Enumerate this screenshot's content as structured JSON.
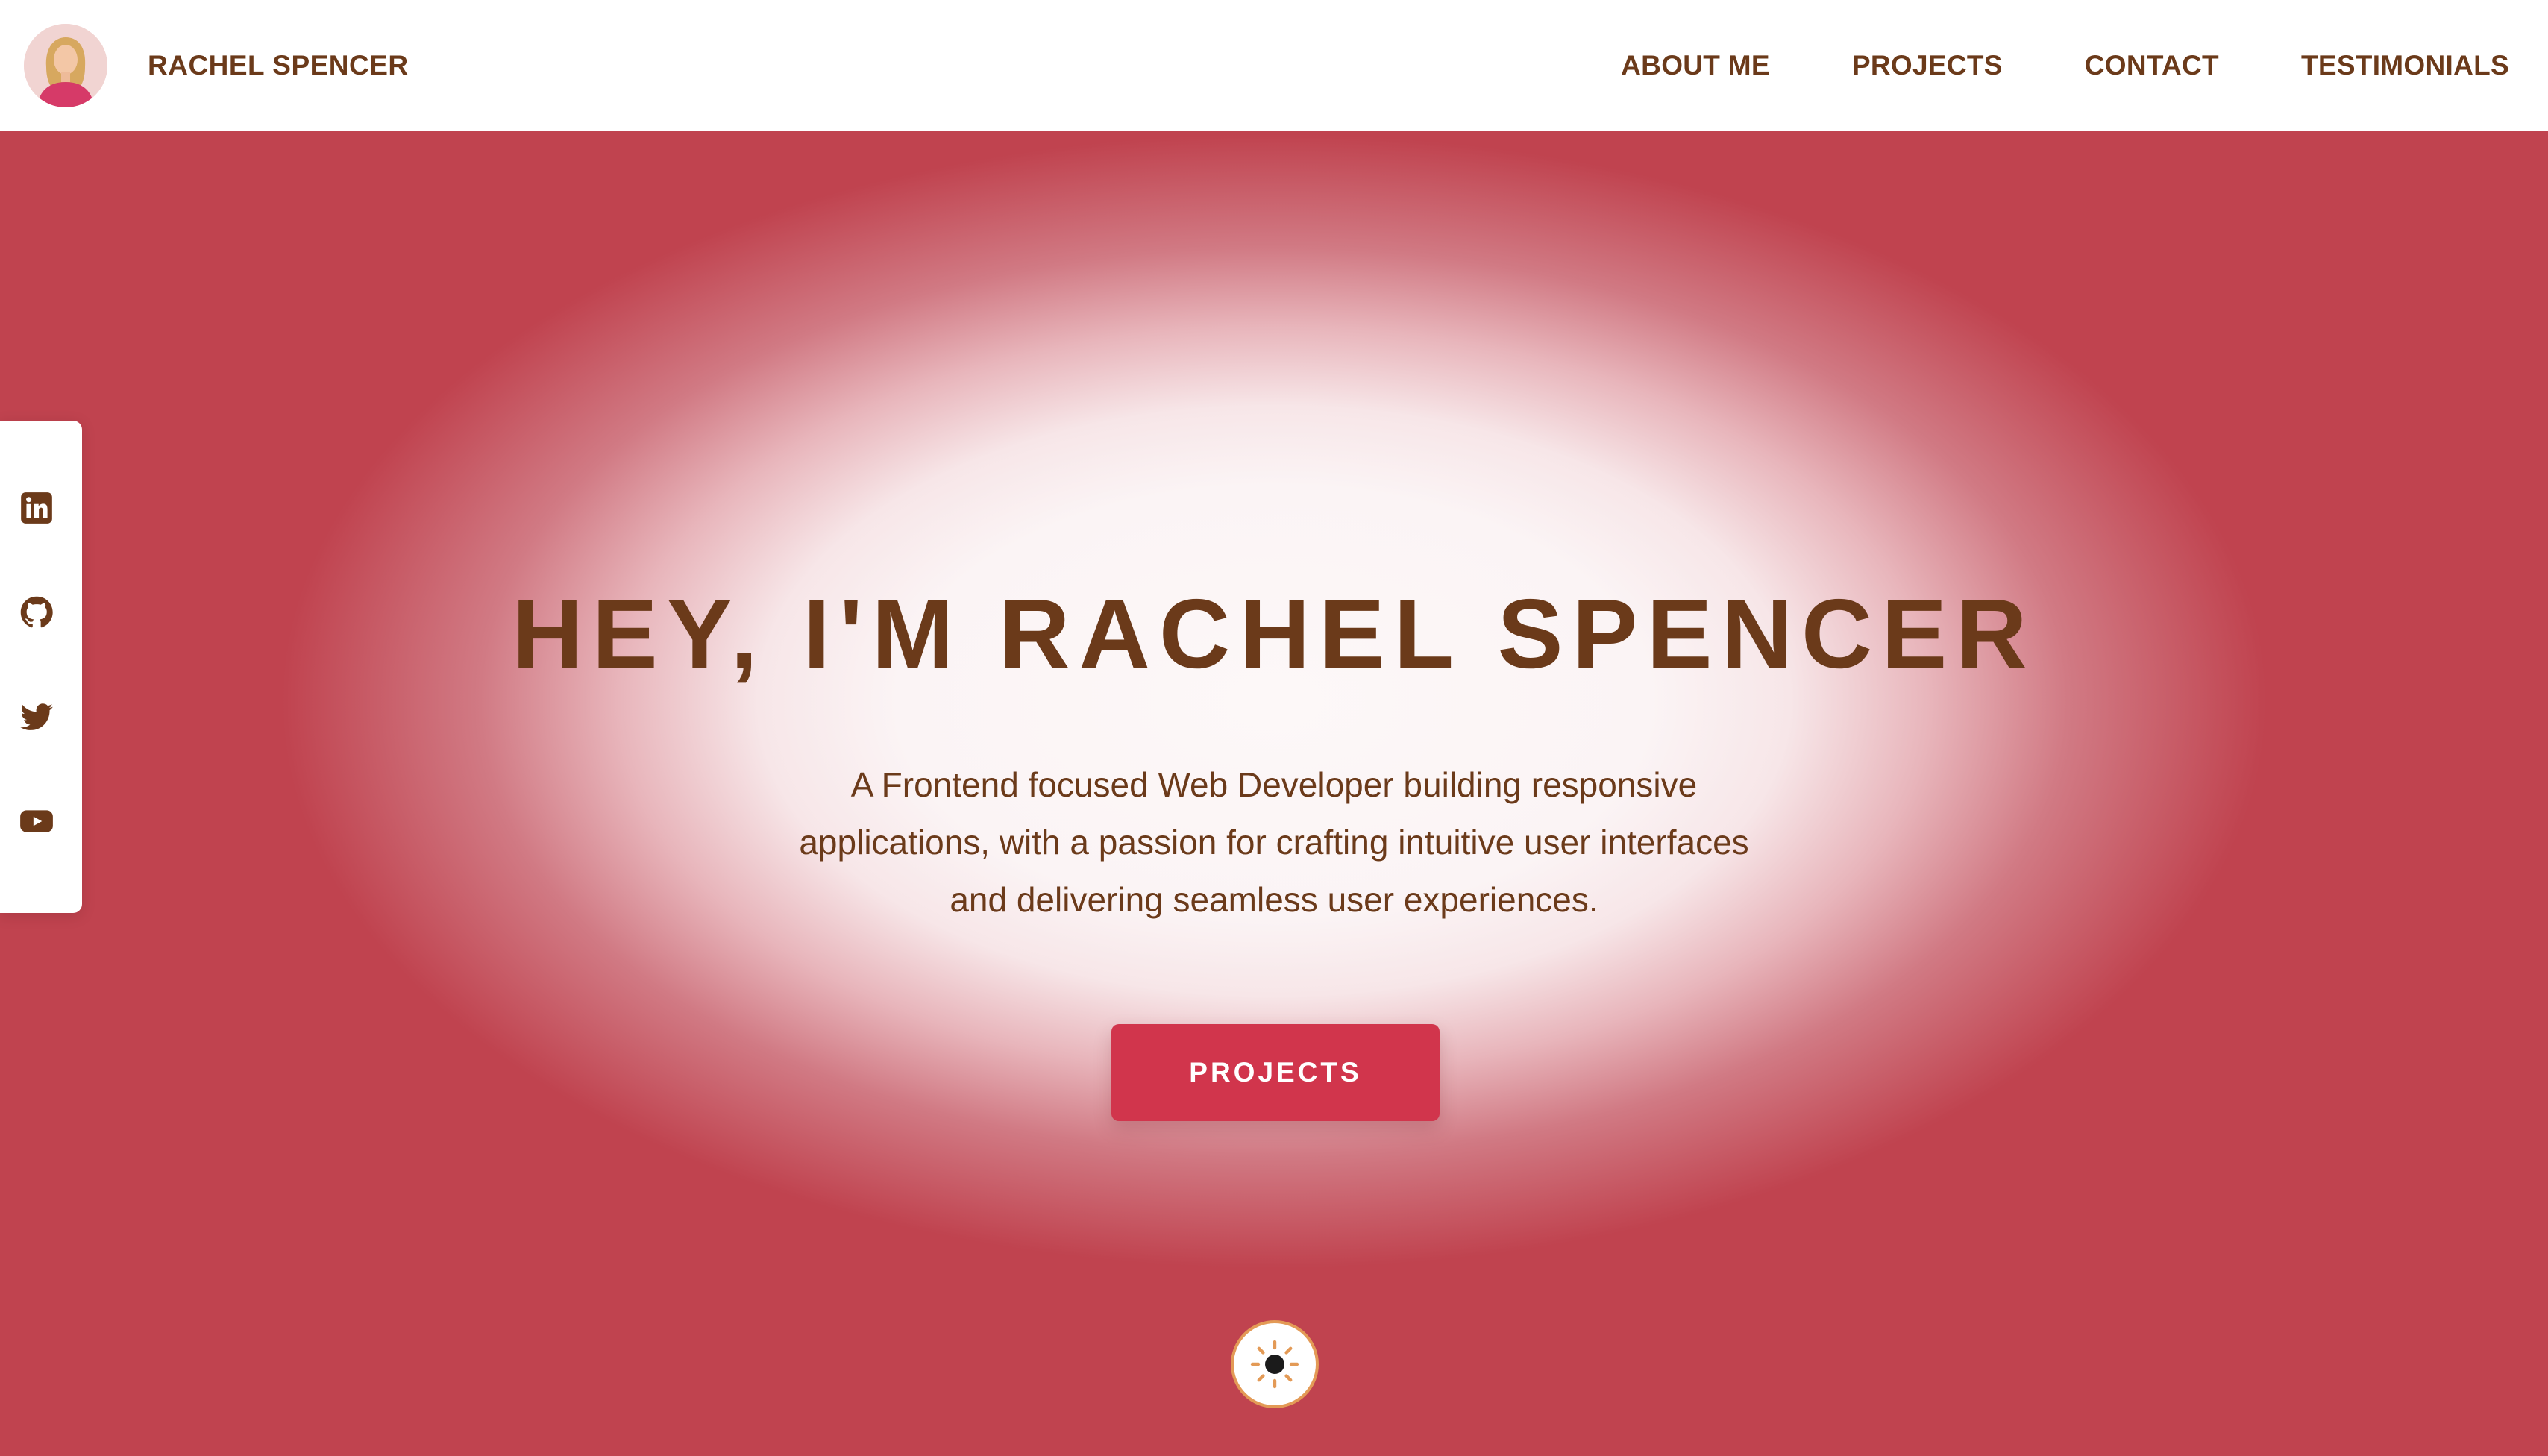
{
  "header": {
    "brand_name": "RACHEL SPENCER",
    "nav": [
      {
        "label": "ABOUT ME"
      },
      {
        "label": "PROJECTS"
      },
      {
        "label": "CONTACT"
      },
      {
        "label": "TESTIMONIALS"
      }
    ]
  },
  "hero": {
    "title": "HEY, I'M RACHEL SPENCER",
    "subtitle": "A Frontend focused Web Developer building responsive applications, with a passion for crafting intuitive user interfaces and delivering seamless user experiences.",
    "cta_label": "PROJECTS"
  },
  "socials": [
    {
      "icon": "linkedin-icon"
    },
    {
      "icon": "github-icon"
    },
    {
      "icon": "twitter-icon"
    },
    {
      "icon": "youtube-icon"
    }
  ],
  "theme_toggle": {
    "icon": "sun-icon"
  },
  "colors": {
    "brand_text": "#6b3a1a",
    "accent": "#d1354c",
    "background_edge": "#c0434f",
    "toggle_ring": "#e39a56"
  }
}
